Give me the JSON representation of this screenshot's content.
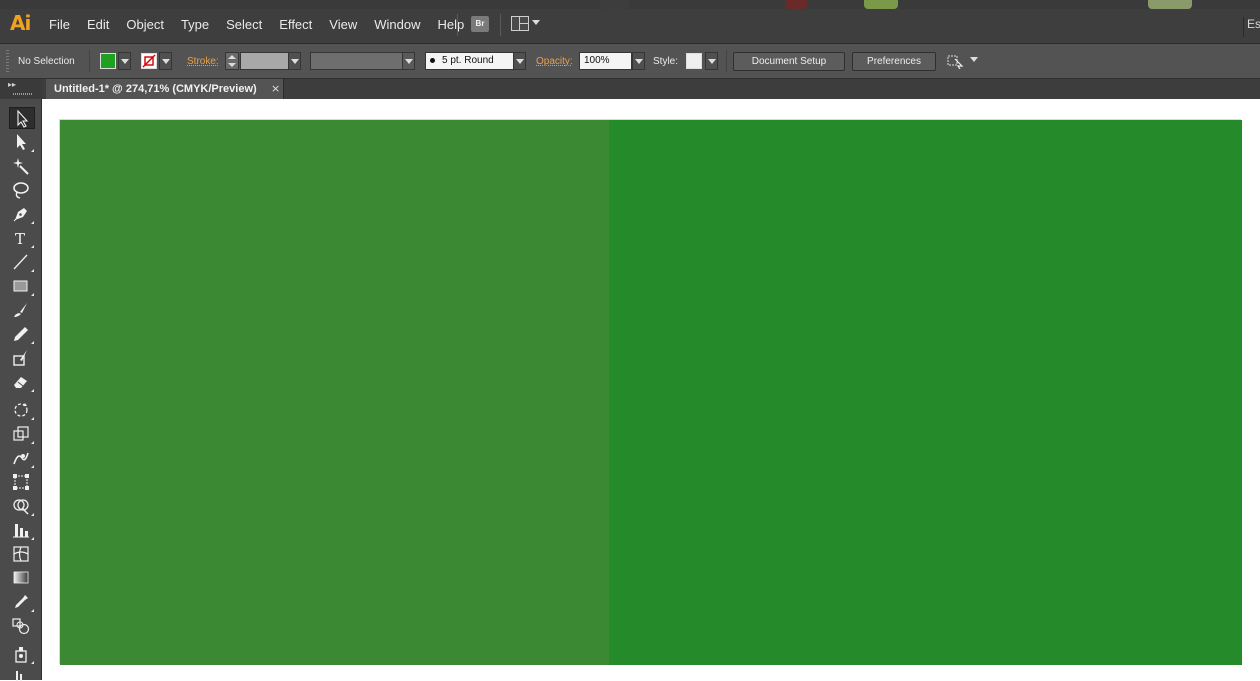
{
  "app": {
    "logo": "Ai",
    "workspace_partial": "Ess"
  },
  "menu": [
    "File",
    "Edit",
    "Object",
    "Type",
    "Select",
    "Effect",
    "View",
    "Window",
    "Help"
  ],
  "bridge_button": "Br",
  "control_bar": {
    "selection_label": "No Selection",
    "fill_color": "#20a020",
    "stroke_label": "Stroke:",
    "brush_label": "5 pt. Round",
    "opacity_label": "Opacity:",
    "opacity_value": "100%",
    "style_label": "Style:",
    "document_setup": "Document Setup",
    "preferences": "Preferences"
  },
  "document_tab": {
    "title": "Untitled-1* @ 274,71% (CMYK/Preview)",
    "close": "×"
  },
  "tools": [
    "selection-tool",
    "direct-selection-tool",
    "magic-wand-tool",
    "lasso-tool",
    "pen-tool",
    "type-tool",
    "line-segment-tool",
    "rectangle-tool",
    "paintbrush-tool",
    "pencil-tool",
    "blob-brush-tool",
    "eraser-tool",
    "rotate-tool",
    "scale-tool",
    "warp-tool",
    "free-transform-tool",
    "shape-builder-tool",
    "graph-tool",
    "mesh-tool",
    "gradient-tool",
    "eyedropper-tool",
    "blend-tool",
    "symbol-sprayer-tool"
  ],
  "canvas": {
    "left_rect_color": "#3b8a33",
    "right_rect_color": "#258a2a"
  }
}
